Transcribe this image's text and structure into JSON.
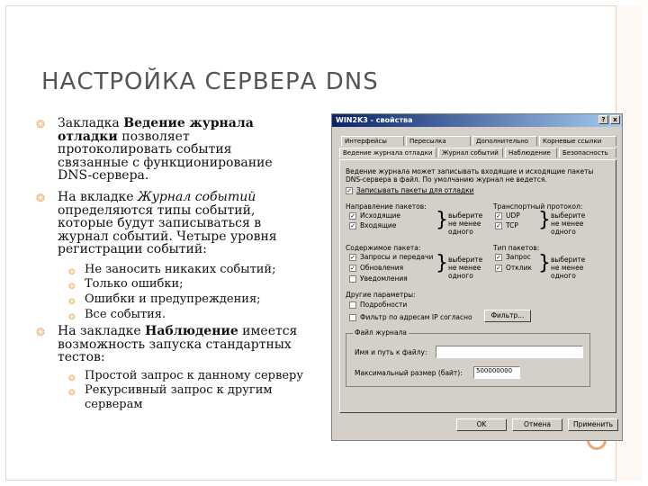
{
  "slide": {
    "title": "НАСТРОЙКА СЕРВЕРА DNS",
    "bullets": [
      {
        "pre": "Закладка ",
        "em": "Ведение журнала отладки",
        "post": " позволяет протоколировать события связанные с функционирование DNS-сервера."
      },
      {
        "pre": "На вкладке ",
        "em": "Журнал событий",
        "post": " определяются типы событий, которые будут записываться в журнал событий. Четыре уровня регистрации событий:"
      },
      {
        "pre": "На закладке ",
        "em": "Наблюдение",
        "post": " имеется возможность запуска стандартных тестов:"
      }
    ],
    "sub_bullets_1": [
      "Не заносить никаких событий;",
      "Только ошибки;",
      "Ошибки и предупреждения;",
      "Все события."
    ],
    "sub_bullets_2": [
      "Простой запрос  к данному серверу",
      "Рекурсивный запрос к другим серверам"
    ]
  },
  "dialog": {
    "title": "WIN2K3 - свойства",
    "title_buttons": [
      "?",
      "x"
    ],
    "tabs_row1": [
      "Интерфейсы",
      "Пересылка",
      "Дополнительно",
      "Корневые ссылки"
    ],
    "tabs_row2": [
      "Ведение журнала отладки",
      "Журнал событий",
      "Наблюдение",
      "Безопасность"
    ],
    "description": [
      "Ведение журнала может записывать входящие и исходящие пакеты",
      "DNS-сервера в файл. По умолчанию журнал не ведется."
    ],
    "main_checkbox": "Записывать пакеты для отладки",
    "groups": {
      "direction_label": "Направление пакетов:",
      "direction_items": [
        {
          "label": "Исходящие",
          "checked": true
        },
        {
          "label": "Входящие",
          "checked": true
        }
      ],
      "direction_note": [
        "выберите",
        "не менее",
        "одного"
      ],
      "protocol_label": "Транспортный протокол:",
      "protocol_items": [
        {
          "label": "UDP",
          "checked": true
        },
        {
          "label": "TCP",
          "checked": true
        }
      ],
      "protocol_note": [
        "выберите",
        "не менее",
        "одного"
      ],
      "content_label": "Содержимое пакета:",
      "content_items": [
        {
          "label": "Запросы и передачи",
          "checked": true
        },
        {
          "label": "Обновления",
          "checked": true
        },
        {
          "label": "Уведомления",
          "checked": false
        }
      ],
      "content_note": [
        "выберите",
        "не менее",
        "одного"
      ],
      "type_label": "Тип пакетов:",
      "type_items": [
        {
          "label": "Запрос",
          "checked": true
        },
        {
          "label": "Отклик",
          "checked": true
        }
      ],
      "type_note": [
        "выберите",
        "не менее",
        "одного"
      ]
    },
    "other_label": "Другие параметры:",
    "other_items": [
      {
        "label": "Подробности",
        "checked": false
      },
      {
        "label": "Фильтр по адресам IP согласно",
        "checked": false
      }
    ],
    "filter_button": "Фильтр...",
    "log_group_label": "Файл журнала",
    "file_path_label": "Имя и путь к файлу:",
    "file_path_value": "",
    "max_size_label": "Максимальный размер (байт):",
    "max_size_value": "500000000",
    "buttons": {
      "ok": "OK",
      "cancel": "Отмена",
      "apply": "Применить"
    }
  }
}
